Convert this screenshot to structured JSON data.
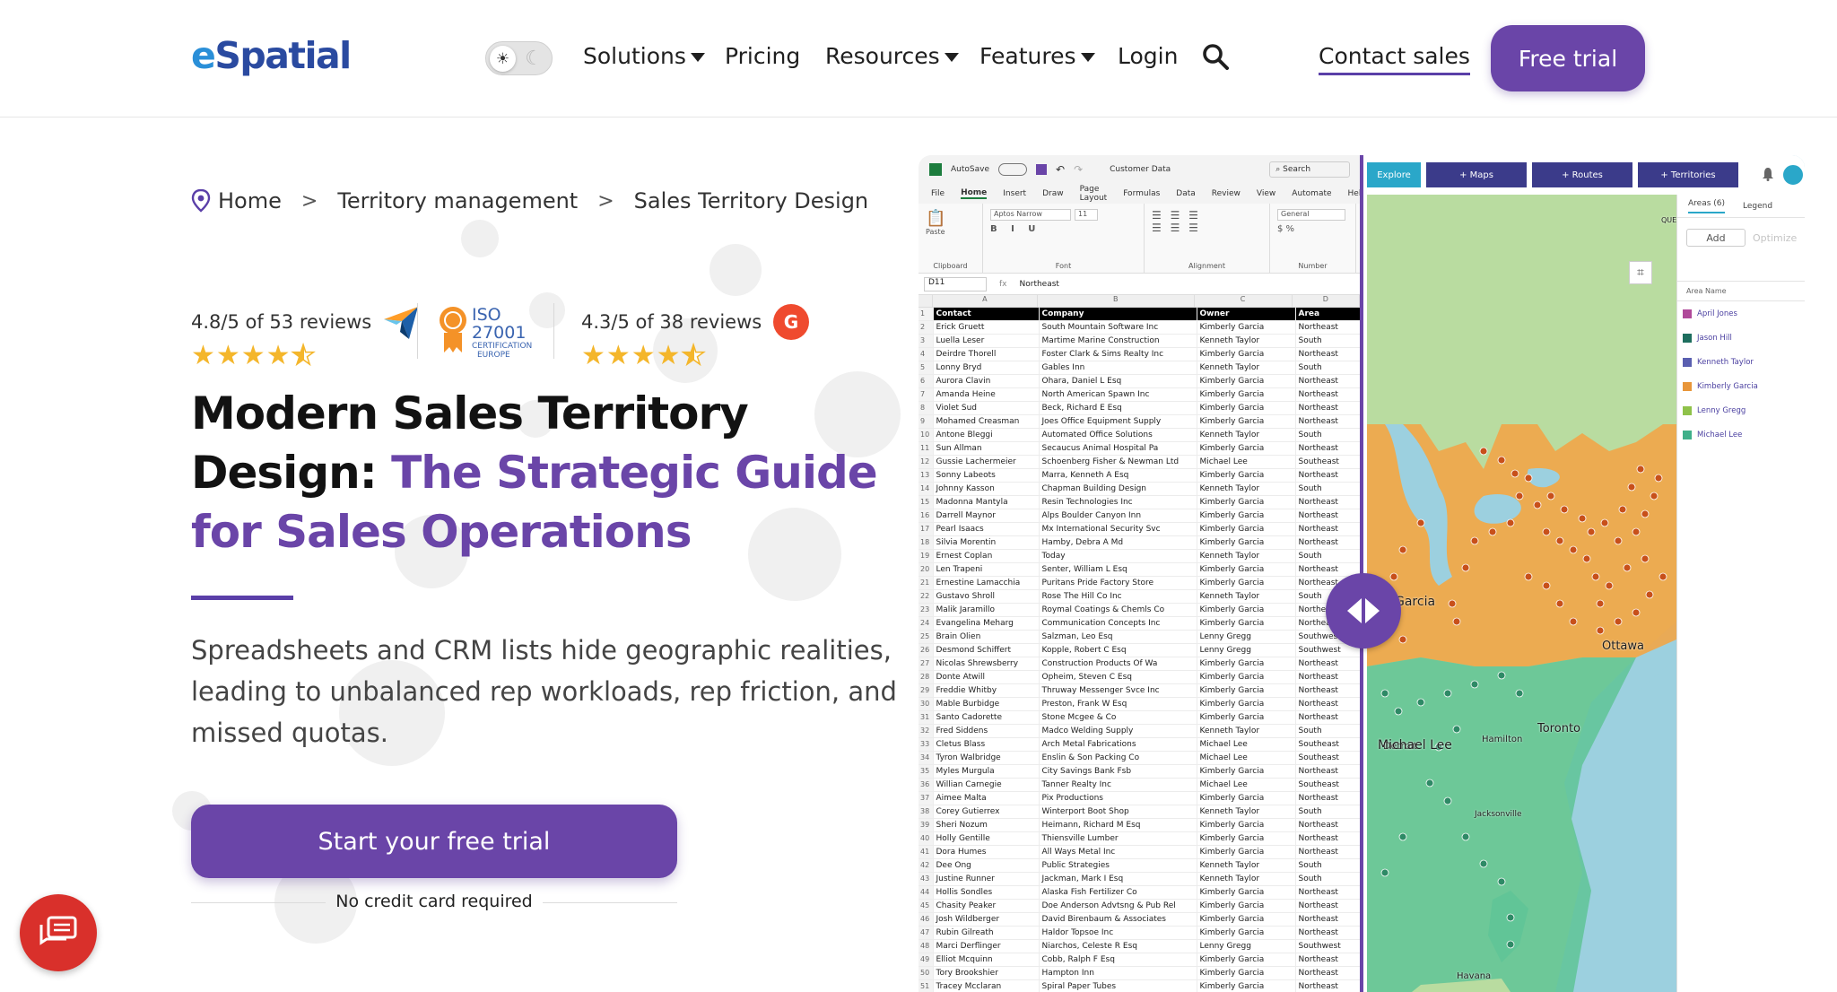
{
  "header": {
    "logo": "eSpatial",
    "nav": [
      {
        "label": "Solutions",
        "dropdown": true
      },
      {
        "label": "Pricing",
        "dropdown": false
      },
      {
        "label": "Resources",
        "dropdown": true
      },
      {
        "label": "Features",
        "dropdown": true
      },
      {
        "label": "Login",
        "dropdown": false
      }
    ],
    "contact_label": "Contact sales",
    "free_trial_label": "Free trial",
    "theme_toggle": {
      "state": "light",
      "icons": [
        "sun-icon",
        "moon-icon"
      ]
    }
  },
  "breadcrumb": [
    "Home",
    "Territory management",
    "Sales Territory Design"
  ],
  "ratings": {
    "left": {
      "text": "4.8/5 of 53 reviews",
      "stars": 4.5
    },
    "iso": {
      "line1": "ISO",
      "line2": "27001",
      "line3": "CERTIFICATION",
      "line4": "EUROPE"
    },
    "right": {
      "text": "4.3/5 of 38 reviews",
      "stars": 4.5
    }
  },
  "hero": {
    "headline_plain": "Modern Sales Territory Design:",
    "headline_accent": "The Strategic Guide for Sales Operations",
    "lead": "Spreadsheets and CRM lists hide geographic realities, leading to unbalanced rep workloads, rep friction, and missed quotas.",
    "cta": "Start your free trial",
    "cta_note": "No credit card required"
  },
  "colors": {
    "brand_purple": "#6a45a8",
    "cta_purple": "#6a45a8",
    "chat_red": "#d9302b",
    "star": "#f4b62b"
  },
  "excel": {
    "title": "Customer Data",
    "autosave": "AutoSave",
    "search": "Search",
    "tabs": [
      "File",
      "Home",
      "Insert",
      "Draw",
      "Page Layout",
      "Formulas",
      "Data",
      "Review",
      "View",
      "Automate",
      "Help"
    ],
    "ribbon_groups": [
      "Clipboard",
      "Font",
      "Alignment",
      "Number"
    ],
    "font_name": "Aptos Narrow",
    "font_size": "11",
    "number_format": "General",
    "paste": "Paste",
    "cell_ref": "D11",
    "formula_value": "Northeast",
    "columns": [
      "A",
      "B",
      "C",
      "D"
    ],
    "headers": [
      "Contact",
      "Company",
      "Owner",
      "Area"
    ],
    "rows": [
      [
        "Erick Gruett",
        "South Mountain Software Inc",
        "Kimberly Garcia",
        "Northeast"
      ],
      [
        "Luella Leser",
        "Martime Marine Construction",
        "Kenneth Taylor",
        "South"
      ],
      [
        "Deirdre Thorell",
        "Foster Clark & Sims Realty Inc",
        "Kimberly Garcia",
        "Northeast"
      ],
      [
        "Lonny Bryd",
        "Gables Inn",
        "Kenneth Taylor",
        "South"
      ],
      [
        "Aurora Clavin",
        "Ohara, Daniel L Esq",
        "Kimberly Garcia",
        "Northeast"
      ],
      [
        "Amanda Heine",
        "North American Spawn Inc",
        "Kimberly Garcia",
        "Northeast"
      ],
      [
        "Violet Sud",
        "Beck, Richard E Esq",
        "Kimberly Garcia",
        "Northeast"
      ],
      [
        "Mohamed Creasman",
        "Joes Office Equipment Supply",
        "Kimberly Garcia",
        "Northeast"
      ],
      [
        "Antone Bleggi",
        "Automated Office Solutions",
        "Kenneth Taylor",
        "South"
      ],
      [
        "Sun Allman",
        "Secaucus Animal Hospital Pa",
        "Kimberly Garcia",
        "Northeast"
      ],
      [
        "Gussie Lachermeier",
        "Schoenberg Fisher & Newman Ltd",
        "Michael Lee",
        "Southeast"
      ],
      [
        "Sonny Labeots",
        "Marra, Kenneth A Esq",
        "Kimberly Garcia",
        "Northeast"
      ],
      [
        "Johnny Kasson",
        "Chapman Building Design",
        "Kenneth Taylor",
        "South"
      ],
      [
        "Madonna Mantyla",
        "Resin Technologies Inc",
        "Kimberly Garcia",
        "Northeast"
      ],
      [
        "Darrell Maynor",
        "Alps Boulder Canyon Inn",
        "Kimberly Garcia",
        "Northeast"
      ],
      [
        "Pearl Isaacs",
        "Mx International Security Svc",
        "Kimberly Garcia",
        "Northeast"
      ],
      [
        "Silvia Morentin",
        "Hamby, Debra A Md",
        "Kimberly Garcia",
        "Northeast"
      ],
      [
        "Ernest Coplan",
        "Today",
        "Kenneth Taylor",
        "South"
      ],
      [
        "Len Trapeni",
        "Senter, William L Esq",
        "Kimberly Garcia",
        "Northeast"
      ],
      [
        "Ernestine Lamacchia",
        "Puritans Pride Factory Store",
        "Kimberly Garcia",
        "Northeast"
      ],
      [
        "Gustavo Shroll",
        "Rose The Hill Co Inc",
        "Kenneth Taylor",
        "South"
      ],
      [
        "Malik Jaramillo",
        "Roymal Coatings & Chemls Co",
        "Kimberly Garcia",
        "Northeast"
      ],
      [
        "Evangelina Meharg",
        "Communication Concepts Inc",
        "Kimberly Garcia",
        "Northeast"
      ],
      [
        "Brain Olien",
        "Salzman, Leo Esq",
        "Lenny Gregg",
        "Southwest"
      ],
      [
        "Desmond Schiffert",
        "Kopple, Robert C Esq",
        "Lenny Gregg",
        "Southwest"
      ],
      [
        "Nicolas Shrewsberry",
        "Construction Products Of Wa",
        "Kimberly Garcia",
        "Northeast"
      ],
      [
        "Donte Atwill",
        "Opheim, Steven C Esq",
        "Kimberly Garcia",
        "Northeast"
      ],
      [
        "Freddie Whitby",
        "Thruway Messenger Svce Inc",
        "Kimberly Garcia",
        "Northeast"
      ],
      [
        "Mable Burbidge",
        "Preston, Frank W Esq",
        "Kimberly Garcia",
        "Northeast"
      ],
      [
        "Santo Cadorette",
        "Stone Mcgee & Co",
        "Kimberly Garcia",
        "Northeast"
      ],
      [
        "Fred Siddens",
        "Madco Welding Supply",
        "Kenneth Taylor",
        "South"
      ],
      [
        "Cletus Blass",
        "Arch Metal Fabrications",
        "Michael Lee",
        "Southeast"
      ],
      [
        "Tyron Walbridge",
        "Enslin & Son Packing Co",
        "Michael Lee",
        "Southeast"
      ],
      [
        "Myles Murgula",
        "City Savings Bank Fsb",
        "Kimberly Garcia",
        "Northeast"
      ],
      [
        "Willian Carnegie",
        "Tanner Realty Inc",
        "Michael Lee",
        "Southeast"
      ],
      [
        "Aimee Malta",
        "Pix Productions",
        "Kimberly Garcia",
        "Northeast"
      ],
      [
        "Corey Gutierrex",
        "Winterport Boot Shop",
        "Kenneth Taylor",
        "South"
      ],
      [
        "Sheri Nozum",
        "Heimann, Richard M Esq",
        "Kimberly Garcia",
        "Northeast"
      ],
      [
        "Holly Gentille",
        "Thiensville Lumber",
        "Kimberly Garcia",
        "Northeast"
      ],
      [
        "Dora Humes",
        "All Ways Metal Inc",
        "Kimberly Garcia",
        "Northeast"
      ],
      [
        "Dee Ong",
        "Public Strategies",
        "Kenneth Taylor",
        "South"
      ],
      [
        "Justine Runner",
        "Jackman, Mark I Esq",
        "Kenneth Taylor",
        "South"
      ],
      [
        "Hollis Sondles",
        "Alaska Fish Fertilizer Co",
        "Kimberly Garcia",
        "Northeast"
      ],
      [
        "Chasity Peaker",
        "Doe Anderson Advtsng & Pub Rel",
        "Kimberly Garcia",
        "Northeast"
      ],
      [
        "Josh Wildberger",
        "David Birenbaum & Associates",
        "Kimberly Garcia",
        "Northeast"
      ],
      [
        "Rubin Gilreath",
        "Haldor Topsoe Inc",
        "Kimberly Garcia",
        "Northeast"
      ],
      [
        "Marci Derflinger",
        "Niarchos, Celeste R Esq",
        "Lenny Gregg",
        "Southwest"
      ],
      [
        "Elliot Mcquinn",
        "Cobb, Ralph F Esq",
        "Kimberly Garcia",
        "Northeast"
      ],
      [
        "Tory Brookshier",
        "Hampton Inn",
        "Kimberly Garcia",
        "Northeast"
      ],
      [
        "Tracey Mcclaran",
        "Spiral Paper Tubes",
        "Kimberly Garcia",
        "Northeast"
      ]
    ]
  },
  "map": {
    "toolbar": [
      "Explore",
      "+ Maps",
      "+ Routes",
      "+ Territories"
    ],
    "panel_tabs": [
      "Areas (6)",
      "Legend"
    ],
    "add_label": "Add",
    "optimize_label": "Optimize",
    "area_header": "Area Name",
    "areas": [
      {
        "name": "April Jones",
        "color": "#b04a9a"
      },
      {
        "name": "Jason Hill",
        "color": "#1e6e5e"
      },
      {
        "name": "Kenneth Taylor",
        "color": "#5a5fb0"
      },
      {
        "name": "Kimberly Garcia",
        "color": "#e8963a"
      },
      {
        "name": "Lenny Gregg",
        "color": "#8fc24a"
      },
      {
        "name": "Michael Lee",
        "color": "#3fb08a"
      }
    ],
    "labels": [
      "Ottawa",
      "Toronto",
      "Hamilton",
      "Detroit",
      "erly Garcia",
      "Michael Lee",
      "Jacksonville",
      "Havana",
      "QUE"
    ]
  }
}
